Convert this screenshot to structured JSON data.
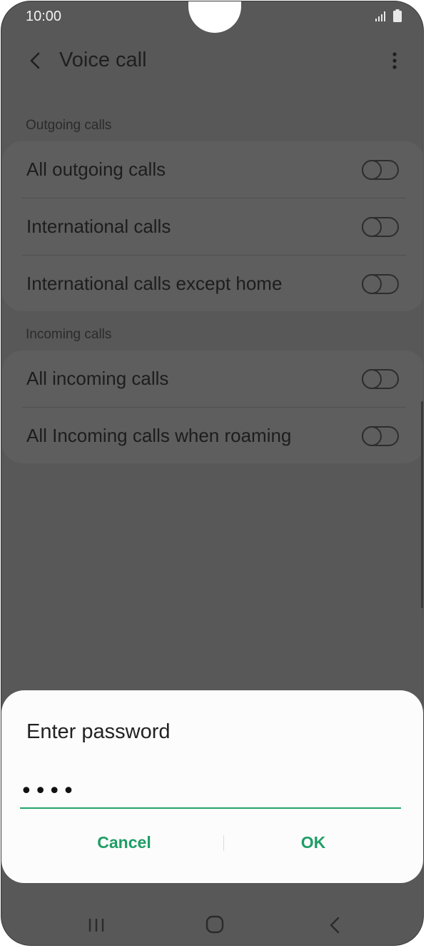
{
  "status": {
    "time": "10:00",
    "icons": [
      "signal-icon",
      "battery-icon"
    ]
  },
  "appbar": {
    "title": "Voice call",
    "icons": [
      "back-arrow-icon",
      "more-options-icon"
    ]
  },
  "sections": {
    "outgoing": {
      "label": "Outgoing calls",
      "items": [
        {
          "label": "All outgoing calls",
          "on": false
        },
        {
          "label": "International calls",
          "on": false
        },
        {
          "label": "International calls except home",
          "on": false
        }
      ]
    },
    "incoming": {
      "label": "Incoming calls",
      "items": [
        {
          "label": "All incoming calls",
          "on": false
        },
        {
          "label": "All Incoming calls when roaming",
          "on": false
        }
      ]
    }
  },
  "dialog": {
    "title": "Enter password",
    "password_value": "••••",
    "cancel_label": "Cancel",
    "ok_label": "OK"
  },
  "navbar": {
    "icons": [
      "recents-icon",
      "home-icon",
      "back-icon"
    ]
  },
  "colors": {
    "accent": "#1f9d66",
    "scrim": "#585858",
    "dialog_bg": "#fcfcfc"
  }
}
